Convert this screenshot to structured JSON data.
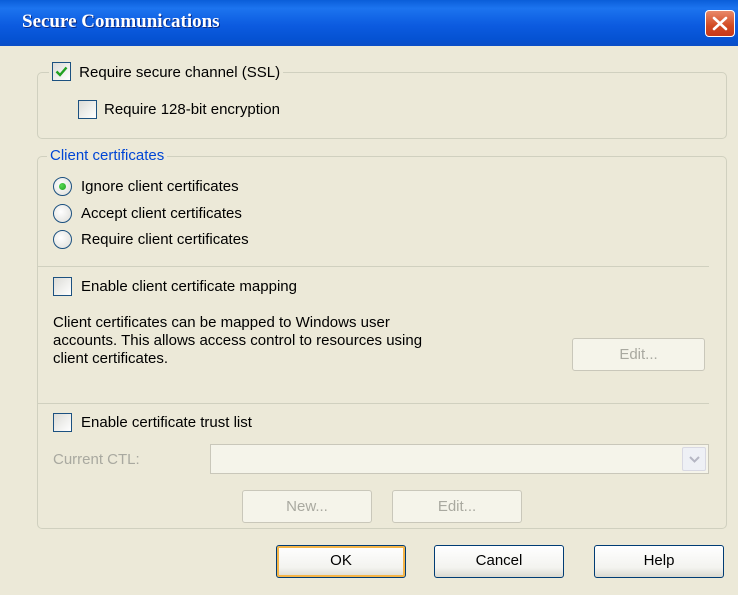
{
  "window": {
    "title": "Secure Communications"
  },
  "ssl_group": {
    "require_ssl_label": "Require secure channel (SSL)",
    "require_ssl_checked": true,
    "require_128bit_label": "Require 128-bit encryption",
    "require_128bit_checked": false
  },
  "client_certificates": {
    "legend": "Client certificates",
    "options": [
      {
        "label": "Ignore client certificates",
        "selected": true
      },
      {
        "label": "Accept client certificates",
        "selected": false
      },
      {
        "label": "Require client certificates",
        "selected": false
      }
    ],
    "mapping": {
      "checkbox_label": "Enable client certificate mapping",
      "checked": false,
      "description": "Client certificates can be mapped to Windows user\naccounts.  This allows access control to resources using\nclient certificates.",
      "edit_label": "Edit..."
    },
    "ctl": {
      "checkbox_label": "Enable certificate trust list",
      "checked": false,
      "current_ctl_label": "Current CTL:",
      "current_ctl_value": "",
      "new_label": "New...",
      "edit_label": "Edit..."
    }
  },
  "footer": {
    "ok_label": "OK",
    "cancel_label": "Cancel",
    "help_label": "Help"
  },
  "colors": {
    "title_bar": "#0a5ed9",
    "dialog_bg": "#ece9d8",
    "legend_text": "#0046d5",
    "checkmark": "#21a121",
    "close_button": "#d24a22",
    "default_button_highlight": "#f4b447"
  }
}
